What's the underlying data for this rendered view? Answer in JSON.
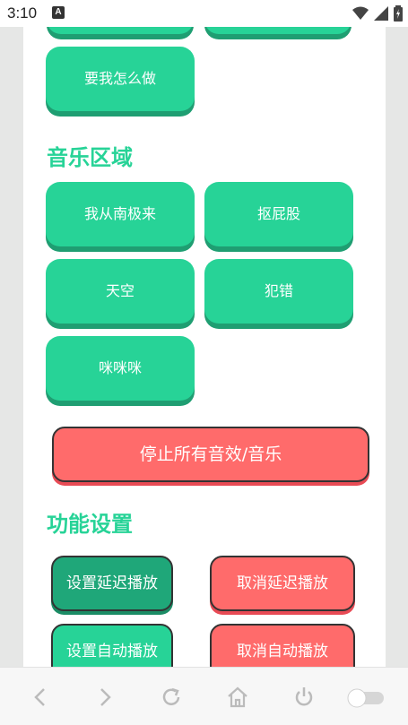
{
  "status_bar": {
    "time": "3:10",
    "notification_badge": "A",
    "icons": [
      "wifi-icon",
      "signal-icon",
      "battery-charging-icon"
    ]
  },
  "sound_buttons": {
    "partial_top": [
      "",
      ""
    ],
    "yao_wo": "要我怎么做"
  },
  "music_section": {
    "title": "音乐区域",
    "items": [
      "我从南极来",
      "抠屁股",
      "天空",
      "犯错",
      "咪咪咪"
    ]
  },
  "stop_button": "停止所有音效/音乐",
  "settings_section": {
    "title": "功能设置",
    "buttons": [
      "设置延迟播放",
      "取消延迟播放",
      "设置自动播放",
      "取消自动播放"
    ]
  },
  "nav_bar": {
    "icons": [
      "back-icon",
      "forward-icon",
      "refresh-icon",
      "home-icon",
      "power-icon",
      "toggle-icon"
    ]
  },
  "colors": {
    "accent_green": "#27d397",
    "dark_green": "#1fa779",
    "red": "#ff6b6b"
  }
}
